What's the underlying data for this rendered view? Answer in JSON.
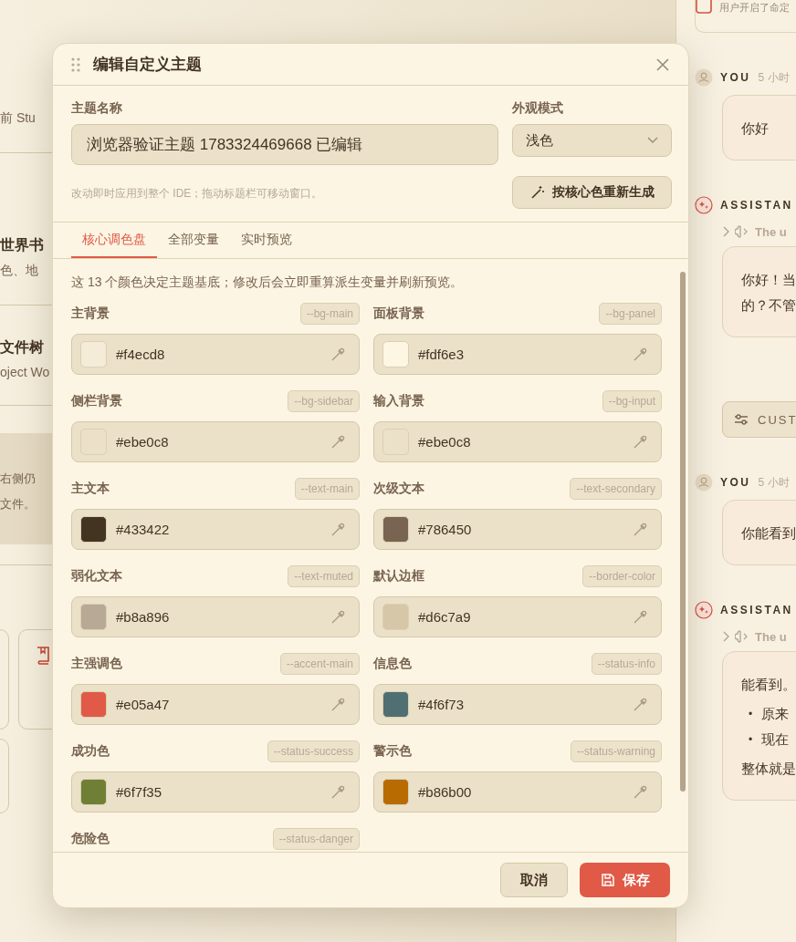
{
  "left_panel": {
    "blocks": [
      {
        "kind": "subtitle",
        "text": "前 Stu"
      },
      {
        "kind": "divider"
      },
      {
        "kind": "heading",
        "text": "世界书"
      },
      {
        "kind": "subtitle",
        "text": "色、地"
      },
      {
        "kind": "divider"
      },
      {
        "kind": "heading",
        "text": "文件树"
      },
      {
        "kind": "subtitle",
        "text": "oject Wo"
      },
      {
        "kind": "divider"
      },
      {
        "kind": "note",
        "lines": [
          "右侧仍",
          "文件。"
        ]
      },
      {
        "kind": "divider"
      },
      {
        "kind": "cards"
      }
    ]
  },
  "chat": {
    "notice": "用户开启了命定",
    "messages": [
      {
        "kind": "user",
        "author": "YOU",
        "time": "5 小时",
        "lines": [
          "你好"
        ]
      },
      {
        "kind": "assistant",
        "author": "ASSISTAN",
        "thinking": "The u",
        "lines": [
          "你好！当",
          "的？不管"
        ]
      },
      {
        "kind": "action",
        "label": "CUST"
      },
      {
        "kind": "user",
        "author": "YOU",
        "time": "5 小时",
        "lines": [
          "你能看到"
        ]
      },
      {
        "kind": "assistant",
        "author": "ASSISTAN",
        "thinking": "The u",
        "lines": [
          "能看到。"
        ],
        "bullet_marker": "•",
        "bullets": [
          "原来",
          "现在"
        ],
        "after": "整体就是"
      }
    ]
  },
  "dialog": {
    "title": "编辑自定义主题",
    "name_label": "主题名称",
    "name_value": "浏览器验证主题 1783324469668 已编辑",
    "mode_label": "外观模式",
    "mode_value": "浅色",
    "hint": "改动即时应用到整个 IDE；拖动标题栏可移动窗口。",
    "regenerate_button": "按核心色重新生成",
    "tabs": [
      {
        "label": "核心调色盘",
        "selected": true
      },
      {
        "label": "全部变量",
        "selected": false
      },
      {
        "label": "实时预览",
        "selected": false
      }
    ],
    "intro": "这 13 个颜色决定主题基底；修改后会立即重算派生变量并刷新预览。",
    "colors": [
      {
        "label": "主背景",
        "variable": "--bg-main",
        "value": "#f4ecd8",
        "color": "#f4ecd8"
      },
      {
        "label": "面板背景",
        "variable": "--bg-panel",
        "value": "#fdf6e3",
        "color": "#fdf6e3"
      },
      {
        "label": "侧栏背景",
        "variable": "--bg-sidebar",
        "value": "#ebe0c8",
        "color": "#ebe0c8"
      },
      {
        "label": "输入背景",
        "variable": "--bg-input",
        "value": "#ebe0c8",
        "color": "#ebe0c8"
      },
      {
        "label": "主文本",
        "variable": "--text-main",
        "value": "#433422",
        "color": "#433422"
      },
      {
        "label": "次级文本",
        "variable": "--text-secondary",
        "value": "#786450",
        "color": "#786450"
      },
      {
        "label": "弱化文本",
        "variable": "--text-muted",
        "value": "#b8a896",
        "color": "#b8a896"
      },
      {
        "label": "默认边框",
        "variable": "--border-color",
        "value": "#d6c7a9",
        "color": "#d6c7a9"
      },
      {
        "label": "主强调色",
        "variable": "--accent-main",
        "value": "#e05a47",
        "color": "#e05a47"
      },
      {
        "label": "信息色",
        "variable": "--status-info",
        "value": "#4f6f73",
        "color": "#4f6f73"
      },
      {
        "label": "成功色",
        "variable": "--status-success",
        "value": "#6f7f35",
        "color": "#6f7f35"
      },
      {
        "label": "警示色",
        "variable": "--status-warning",
        "value": "#b86b00",
        "color": "#b86b00"
      },
      {
        "label": "危险色",
        "variable": "--status-danger"
      }
    ],
    "cancel_button": "取消",
    "save_button": "保存"
  }
}
